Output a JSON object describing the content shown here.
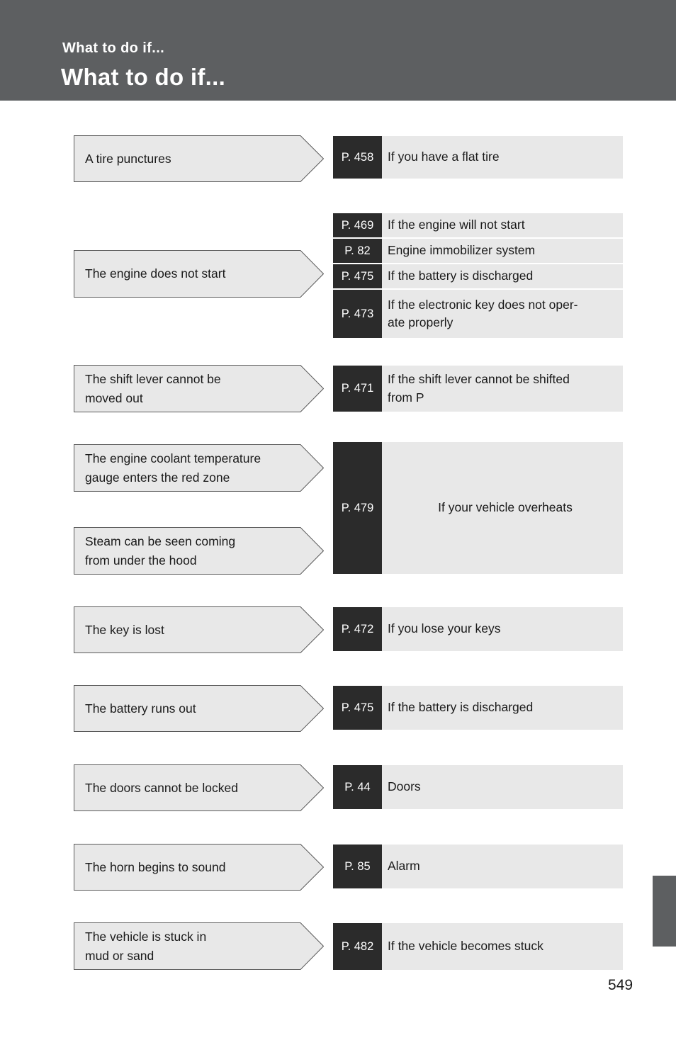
{
  "header": {
    "kicker": "What to do if...",
    "title": "What to do if..."
  },
  "footer": {
    "page_number": "549"
  },
  "colors": {
    "header_bar": "#5d5f61",
    "page_ref_block": "#2b2b2b",
    "panel_grey": "#e8e8e8",
    "text": "#1a1a1a"
  },
  "entries": [
    {
      "cause_lines": [
        "A tire punctures"
      ],
      "results": [
        {
          "page_ref": "P. 458",
          "label_lines": [
            "If you have a flat tire"
          ]
        }
      ]
    },
    {
      "cause_lines": [
        "The engine does not start"
      ],
      "results": [
        {
          "page_ref": "P. 469",
          "label_lines": [
            "If the engine will not start"
          ]
        },
        {
          "page_ref": "P. 82",
          "label_lines": [
            "Engine immobilizer system"
          ]
        },
        {
          "page_ref": "P. 475",
          "label_lines": [
            "If the battery is discharged"
          ]
        },
        {
          "page_ref": "P. 473",
          "label_lines": [
            "If the electronic key does not oper-",
            "ate properly"
          ]
        }
      ]
    },
    {
      "cause_lines": [
        "The shift lever cannot be",
        "moved out"
      ],
      "results": [
        {
          "page_ref": "P. 471",
          "label_lines": [
            "If the shift lever cannot be shifted",
            "from P"
          ]
        }
      ]
    },
    {
      "cause_lines": [
        "The engine coolant temperature",
        "gauge enters the red zone"
      ],
      "cause_lines_2": [
        "Steam can be seen coming",
        "from under the hood"
      ],
      "results": [
        {
          "page_ref": "P. 479",
          "label_lines": [
            "If your vehicle overheats"
          ]
        }
      ]
    },
    {
      "cause_lines": [
        "The key is lost"
      ],
      "results": [
        {
          "page_ref": "P. 472",
          "label_lines": [
            "If you lose your keys"
          ]
        }
      ]
    },
    {
      "cause_lines": [
        "The battery runs out"
      ],
      "results": [
        {
          "page_ref": "P. 475",
          "label_lines": [
            "If the battery is discharged"
          ]
        }
      ]
    },
    {
      "cause_lines": [
        "The doors cannot be locked"
      ],
      "results": [
        {
          "page_ref": "P. 44",
          "label_lines": [
            "Doors"
          ]
        }
      ]
    },
    {
      "cause_lines": [
        "The horn begins to sound"
      ],
      "results": [
        {
          "page_ref": "P. 85",
          "label_lines": [
            "Alarm"
          ]
        }
      ]
    },
    {
      "cause_lines": [
        "The vehicle is stuck in",
        "mud or sand"
      ],
      "results": [
        {
          "page_ref": "P. 482",
          "label_lines": [
            "If the vehicle becomes stuck"
          ]
        }
      ]
    }
  ]
}
